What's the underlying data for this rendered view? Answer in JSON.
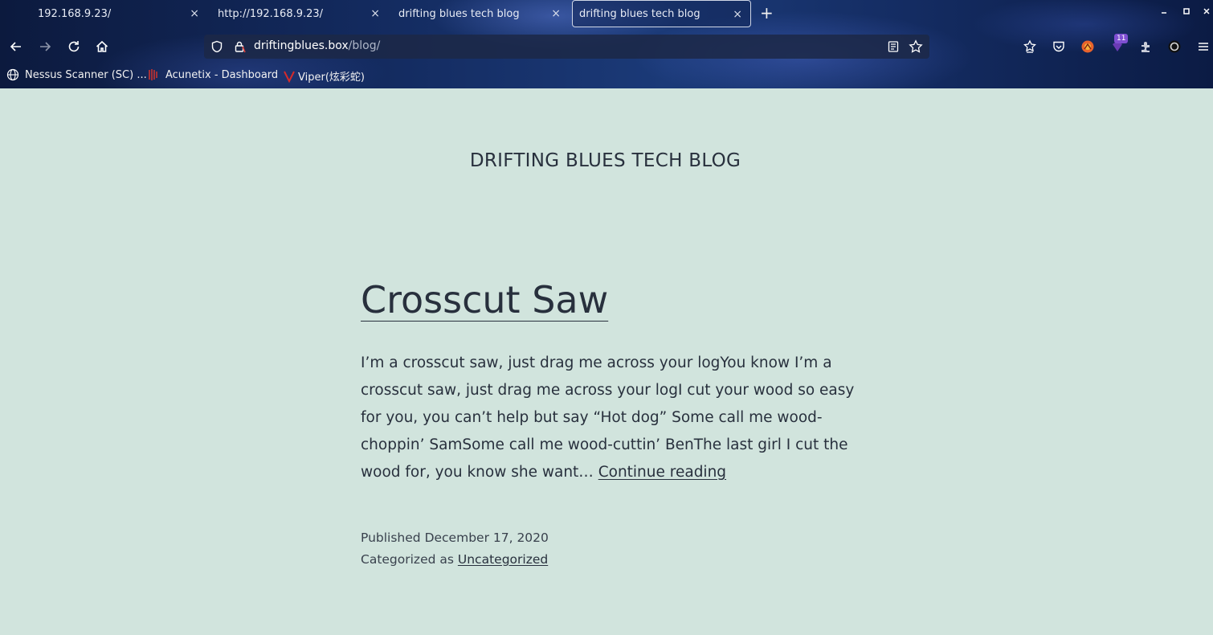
{
  "browser": {
    "tabs": [
      {
        "title": "192.168.9.23/",
        "active": false
      },
      {
        "title": "http://192.168.9.23/",
        "active": false
      },
      {
        "title": "drifting blues tech blog",
        "active": false
      },
      {
        "title": "drifting blues tech blog",
        "active": true
      }
    ],
    "tab_close_glyph": "×",
    "new_tab_glyph": "+",
    "url": {
      "host": "driftingblues.box",
      "path": "/blog/"
    },
    "extension_badge": "11",
    "bookmarks": [
      {
        "label": "Nessus Scanner (SC) ...",
        "icon": "globe-icon"
      },
      {
        "label": "Acunetix - Dashboard",
        "icon": "acunetix-icon"
      },
      {
        "label": "Viper(炫彩蛇)",
        "icon": "viper-icon"
      }
    ],
    "accent_color": "#c9322f"
  },
  "page": {
    "site_title": "DRIFTING BLUES TECH BLOG",
    "post": {
      "title": "Crosscut Saw",
      "excerpt": "I’m a crosscut saw, just drag me across your logYou know I’m a crosscut saw, just drag me across your logI cut your wood so easy for you, you can’t help but say “Hot dog” Some call me wood-choppin’ SamSome call me wood-cuttin’ BenThe last girl I cut the wood for, you know she want…",
      "continue_label": "Continue reading",
      "published_label": "Published",
      "date": "December 17, 2020",
      "categorized_label": "Categorized as",
      "category": "Uncategorized"
    },
    "background_color": "#d1e4dd",
    "text_color": "#28303d"
  }
}
